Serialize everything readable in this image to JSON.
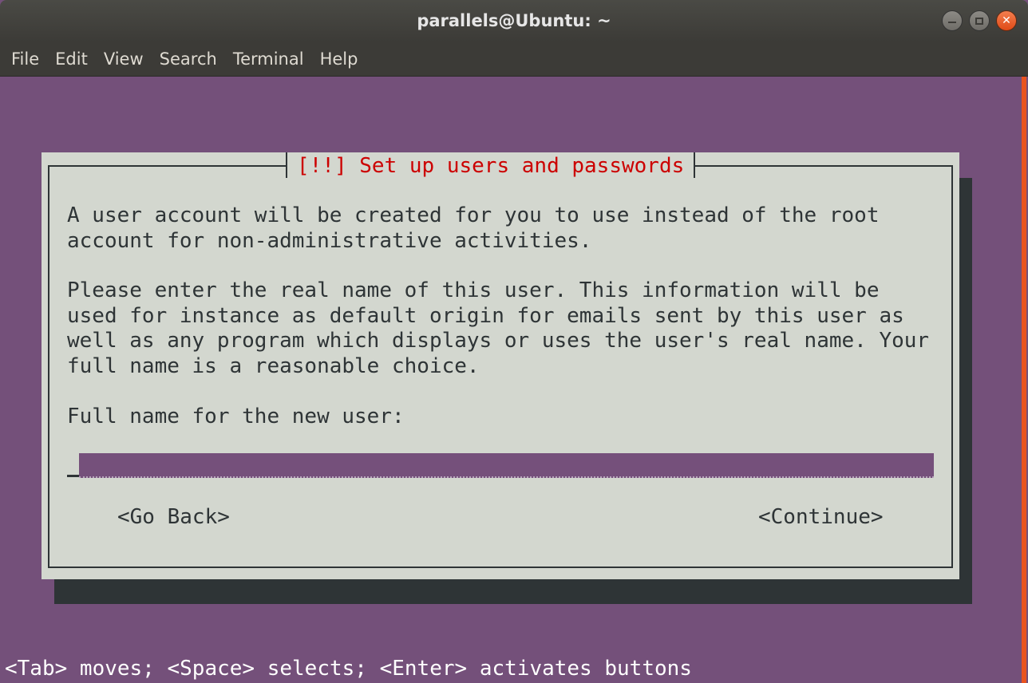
{
  "window": {
    "title": "parallels@Ubuntu: ~",
    "menu": [
      "File",
      "Edit",
      "View",
      "Search",
      "Terminal",
      "Help"
    ]
  },
  "dialog": {
    "title": "[!!] Set up users and passwords",
    "paragraph1": "A user account will be created for you to use instead of the root\naccount for non-administrative activities.",
    "paragraph2": "Please enter the real name of this user. This information will be\nused for instance as default origin for emails sent by this user as\nwell as any program which displays or uses the user's real name. Your\nfull name is a reasonable choice.",
    "prompt": "Full name for the new user:",
    "input_value": "",
    "go_back_label": "<Go Back>",
    "continue_label": "<Continue>"
  },
  "status_line": "<Tab> moves; <Space> selects; <Enter> activates buttons",
  "colors": {
    "terminal_bg": "#74507a",
    "dialog_bg": "#d3d7cf",
    "dialog_title": "#cc0000",
    "shadow": "#2e3436",
    "scrollbar": "#e95420"
  }
}
